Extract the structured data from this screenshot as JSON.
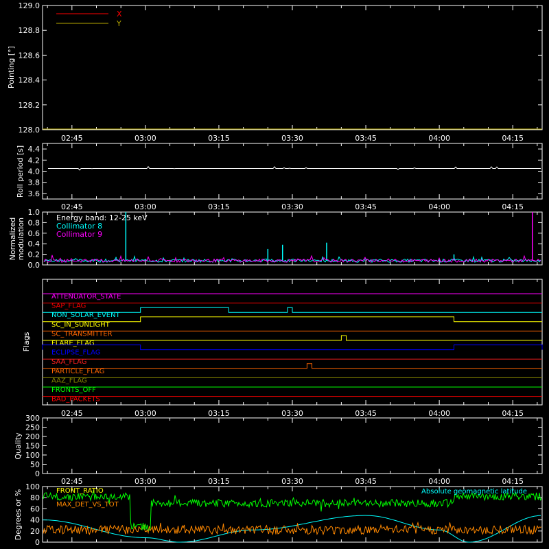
{
  "chart_data": [
    {
      "type": "line",
      "panel": "pointing",
      "ylabel": "Pointing [°]",
      "ylim": [
        128.0,
        129.0
      ],
      "yticks": [
        "128.0",
        "128.2",
        "128.4",
        "128.6",
        "128.8",
        "129.0"
      ],
      "xtick_labels": [
        "02:45",
        "03:00",
        "03:15",
        "03:30",
        "03:45",
        "04:00",
        "04:15"
      ],
      "xrange": [
        "02:39",
        "04:21"
      ],
      "legend_placement": "top-left",
      "series": [
        {
          "name": "X",
          "color": "#ff0000",
          "values": []
        },
        {
          "name": "Y",
          "color": "#b8a800",
          "values": []
        }
      ]
    },
    {
      "type": "line",
      "panel": "roll",
      "ylabel": "Roll period [s]",
      "ylim": [
        3.5,
        4.5
      ],
      "yticks": [
        "3.6",
        "3.8",
        "4.0",
        "4.2",
        "4.4"
      ],
      "xtick_labels": [
        "02:45",
        "03:00",
        "03:15",
        "03:30",
        "03:45",
        "04:00",
        "04:15"
      ],
      "series": [
        {
          "color": "#ffffff",
          "baseline": 4.05
        }
      ]
    },
    {
      "type": "line",
      "panel": "modulation",
      "ylabel": "Normalized modulation",
      "ylim": [
        0.0,
        1.0
      ],
      "yticks": [
        "0.0",
        "0.2",
        "0.4",
        "0.6",
        "0.8",
        "1.0"
      ],
      "annotation": "Energy band: 12-25 keV",
      "series": [
        {
          "name": "Collimator 8",
          "color": "#00ffff",
          "baseline": 0.08,
          "spikes": [
            {
              "t": "02:54",
              "v": 0.15
            },
            {
              "t": "02:56",
              "v": 1.0
            },
            {
              "t": "03:25",
              "v": 0.3
            },
            {
              "t": "03:28",
              "v": 0.38
            },
            {
              "t": "03:37",
              "v": 0.42
            },
            {
              "t": "04:03",
              "v": 0.2
            }
          ]
        },
        {
          "name": "Collimator 9",
          "color": "#ff00ff",
          "baseline": 0.08,
          "spikes": [
            {
              "t": "04:19",
              "v": 1.0
            }
          ]
        }
      ]
    },
    {
      "type": "line",
      "panel": "flags",
      "ylabel": "Flags",
      "xtick_labels": [
        "02:45",
        "03:00",
        "03:15",
        "03:30",
        "03:45",
        "04:00",
        "04:15"
      ],
      "flags": [
        {
          "name": "ATTENUATOR_STATE",
          "color": "#ff00ff",
          "on": []
        },
        {
          "name": "SAP_FLAG",
          "color": "#ff0000",
          "on": []
        },
        {
          "name": "NON_SOLAR_EVENT",
          "color": "#00ffff",
          "on": [
            [
              "02:59",
              "03:17"
            ],
            [
              "03:29",
              "03:30"
            ]
          ]
        },
        {
          "name": "SC_IN_SUNLIGHT",
          "color": "#ffff00",
          "on": [
            [
              "02:59",
              "04:03"
            ]
          ]
        },
        {
          "name": "SC_TRANSMITTER",
          "color": "#ff6600",
          "on": []
        },
        {
          "name": "FLARE_FLAG",
          "color": "#ffff00",
          "on": [
            [
              "03:40",
              "03:41"
            ]
          ]
        },
        {
          "name": "ECLIPSE_FLAG",
          "color": "#0000ff",
          "on": [
            [
              "02:39",
              "02:59"
            ],
            [
              "04:03",
              "04:21"
            ]
          ]
        },
        {
          "name": "SAA_FLAG",
          "color": "#ff2020",
          "on": []
        },
        {
          "name": "PARTICLE_FLAG",
          "color": "#ff6600",
          "on": [
            [
              "03:33",
              "03:34"
            ]
          ]
        },
        {
          "name": "AAZ_FLAG",
          "color": "#888800",
          "on": []
        },
        {
          "name": "FRONTS_OFF",
          "color": "#00ff00",
          "on": []
        },
        {
          "name": "BAD_PACKETS",
          "color": "#ff0000",
          "on": []
        }
      ]
    },
    {
      "type": "line",
      "panel": "quality",
      "ylabel": "Quality",
      "ylim": [
        0,
        300
      ],
      "yticks": [
        "0",
        "50",
        "100",
        "150",
        "200",
        "250",
        "300"
      ],
      "xtick_labels": [
        "02:45",
        "03:00",
        "03:15",
        "03:30",
        "03:45",
        "04:00",
        "04:15"
      ],
      "series": []
    },
    {
      "type": "line",
      "panel": "ratios",
      "ylabel": "Degrees or %",
      "ylim": [
        0,
        100
      ],
      "yticks": [
        "0",
        "20",
        "40",
        "60",
        "80",
        "100"
      ],
      "series": [
        {
          "name": "FRONT_RATIO",
          "color": "#00ff00",
          "segments": [
            [
              "02:39",
              "02:59",
              82
            ],
            [
              "02:59",
              "04:03",
              70
            ],
            [
              "04:03",
              "04:21",
              82
            ]
          ],
          "dip": 28
        },
        {
          "name": "MAX_DET_VS_TOT",
          "color": "#ff8800",
          "level": 22
        },
        {
          "name": "Absolute geomagnetic latitude",
          "color": "#00ffff",
          "points": [
            [
              "02:39",
              40
            ],
            [
              "03:00",
              8
            ],
            [
              "03:07",
              0
            ],
            [
              "03:22",
              22
            ],
            [
              "03:45",
              48
            ],
            [
              "04:00",
              22
            ],
            [
              "04:06",
              0
            ],
            [
              "04:21",
              48
            ]
          ]
        }
      ]
    }
  ],
  "colors": {
    "background": "#000000",
    "axes": "#ffffff"
  }
}
